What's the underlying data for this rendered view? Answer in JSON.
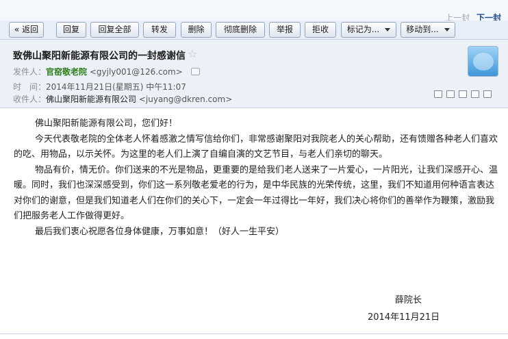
{
  "pager": {
    "prev": "上一封",
    "next": "下一封"
  },
  "toolbar": {
    "back": "« 返回",
    "reply": "回复",
    "reply_all": "回复全部",
    "forward": "转发",
    "delete": "删除",
    "delete_permanently": "彻底删除",
    "report": "举报",
    "reject": "拒收",
    "mark_as": "标记为...",
    "move_to": "移动到..."
  },
  "header": {
    "subject": "致佛山聚阳新能源有限公司的一封感谢信",
    "from_label": "发件人：",
    "from_name": "官窑敬老院",
    "from_email": "<gyjly001@126.com>",
    "time_label": "时　间：",
    "time_value": "2014年11月21日(星期五) 中午11:07",
    "to_label": "收件人：",
    "to_name": "佛山聚阳新能源有限公司",
    "to_email": "<juyang@dkren.com>"
  },
  "body": {
    "greeting": "佛山聚阳新能源有限公司，您们好！",
    "p1": "今天代表敬老院的全体老人怀着感激之情写信给你们，非常感谢聚阳对我院老人的关心帮助，还有馈赠各种老人们喜欢的吃、用物品，以示关怀。为这里的老人们上演了自编自演的文艺节目，与老人们亲切的聊天。",
    "p2": "物品有价，情无价。你们送来的不光是物品，更重要的是给我们老人送来了一片爱心，一片阳光，让我们深感开心、温暖。同时，我们也深深感受到，你们这一系列敬老爱老的行为，是中华民族的光荣传统，这里，我们不知道用何种语言表达对你们的谢意，但是我们知道老人们在你们的关心下，一定会一年过得比一年好，我们决心将你们的善举作为鞭策，激励我们把服务老人工作做得更好。",
    "p3": "最后我们衷心祝愿各位身体健康，万事如意！（好人一生平安）",
    "signature": "薛院长",
    "date": "2014年11月21日"
  }
}
